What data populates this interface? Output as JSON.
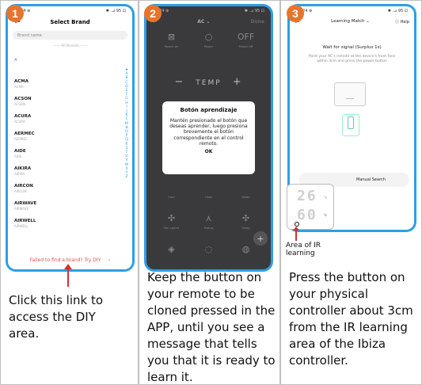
{
  "steps": [
    "1",
    "2",
    "3"
  ],
  "status": {
    "left": "11:24 ⊕",
    "right": "✱ .⊿ 95 ⊡"
  },
  "phone1": {
    "title": "Select Brand",
    "search_placeholder": "Brand name",
    "all_brands": "—— All Brands ——",
    "section_letter": "A",
    "brands": [
      {
        "name": "ACMA",
        "sub": "ACMA"
      },
      {
        "name": "ACSON",
        "sub": "ACSON"
      },
      {
        "name": "ACURA",
        "sub": "ACURA"
      },
      {
        "name": "AERMEC",
        "sub": "AERMEC"
      },
      {
        "name": "AIDE",
        "sub": "AIDE"
      },
      {
        "name": "AIKIRA",
        "sub": "AIKIRA"
      },
      {
        "name": "AIRCON",
        "sub": "AIRCON"
      },
      {
        "name": "AIRWAVE",
        "sub": "AIRWAVE"
      },
      {
        "name": "AIRWELL",
        "sub": "AIRWELL"
      }
    ],
    "alphabet": [
      "★",
      "A",
      "B",
      "C",
      "D",
      "E",
      "F",
      "G",
      "H",
      "I",
      "J",
      "K",
      "L",
      "M",
      "N",
      "O",
      "P",
      "Q",
      "R",
      "S",
      "T",
      "U",
      "V",
      "W",
      "X",
      "Y",
      "Z"
    ],
    "footer_link": "Failed to find a brand? Try DIY",
    "footer_chevron": "›"
  },
  "caption1": "Click this link to access the DIY area.",
  "phone2": {
    "title": "AC ⌄",
    "back": "←",
    "right": "Done",
    "buttons_top": [
      {
        "glyph": "⊠",
        "label": "Power on"
      },
      {
        "glyph": "○",
        "label": "Power"
      },
      {
        "glyph": "OFF",
        "label": "Power off"
      }
    ],
    "temp_minus": "−",
    "temp_label": "TEMP",
    "temp_plus": "+",
    "dialog_title": "Botón aprendizaje",
    "dialog_body": "Mantén presionado el botón que deseas aprender, luego presiona brevemente el botón correspondiente en el control remoto.",
    "dialog_ok": "OK",
    "buttons_mid": [
      {
        "glyph": "",
        "label": "Cool"
      },
      {
        "glyph": "",
        "label": "Heat"
      },
      {
        "glyph": "",
        "label": "Mode"
      }
    ],
    "buttons_bottom": [
      {
        "glyph": "✣",
        "label": "Fan speed"
      },
      {
        "glyph": "⋏",
        "label": "Swing"
      },
      {
        "glyph": "✣",
        "label": "Sleep"
      }
    ],
    "buttons_last": [
      {
        "glyph": "◈",
        "label": ""
      },
      {
        "glyph": "◌",
        "label": ""
      },
      {
        "glyph": "◍",
        "label": ""
      }
    ],
    "fab": "+"
  },
  "caption2": "Keep the button on your remote to be cloned pressed in the APP, until you see a message that tells you that it is ready to learn it.",
  "phone3": {
    "back": "←",
    "title": "Learning Match ⌄",
    "help": "ⓘ Help",
    "wait": "Wait for signal (Surplus 1s)",
    "instructions": "Point your AC's remote at the device's front face within 3cm and press the power button",
    "manual": "Manual Search"
  },
  "device": {
    "digits_top": "26",
    "digits_bottom": "60",
    "unit_top": "°c",
    "unit_bottom": "%"
  },
  "ir_label": "Area of IR learning",
  "caption3": "Press the button on your physical controller about 3cm from the IR learning area of the Ibiza controller."
}
